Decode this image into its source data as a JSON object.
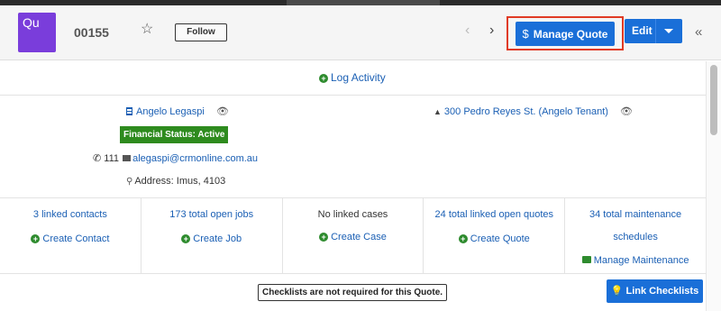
{
  "header": {
    "badge_text": "Qu",
    "record_id": "00155",
    "follow_label": "Follow",
    "manage_quote_label": "Manage Quote",
    "edit_label": "Edit"
  },
  "activity": {
    "log_activity_label": "Log Activity"
  },
  "details": {
    "contact_name": "Angelo Legaspi",
    "financial_status": "Financial Status: Active",
    "phone": "111",
    "email": "alegaspi@crmonline.com.au",
    "address": "Address: Imus, 4103",
    "property": "300 Pedro Reyes St. (Angelo Tenant)"
  },
  "stats": {
    "contacts": {
      "count_label": "3 linked contacts",
      "action_label": "Create Contact"
    },
    "jobs": {
      "count_label": "173 total open jobs",
      "action_label": "Create Job"
    },
    "cases": {
      "count_label": "No linked cases",
      "action_label": "Create Case"
    },
    "quotes": {
      "count_label": "24 total linked open quotes",
      "action_label": "Create Quote"
    },
    "maintenance": {
      "count_label_line1": "34 total maintenance",
      "count_label_line2": "schedules",
      "action_label": "Manage Maintenance"
    }
  },
  "checklists": {
    "message": "Checklists are not required for this Quote.",
    "link_label": "Link Checklists"
  },
  "colors": {
    "badge": "#7a3ddb",
    "primary_button": "#1a6fd8",
    "highlight_border": "#e03a24",
    "status_green": "#2e8b1e",
    "link": "#1a5fb4"
  }
}
